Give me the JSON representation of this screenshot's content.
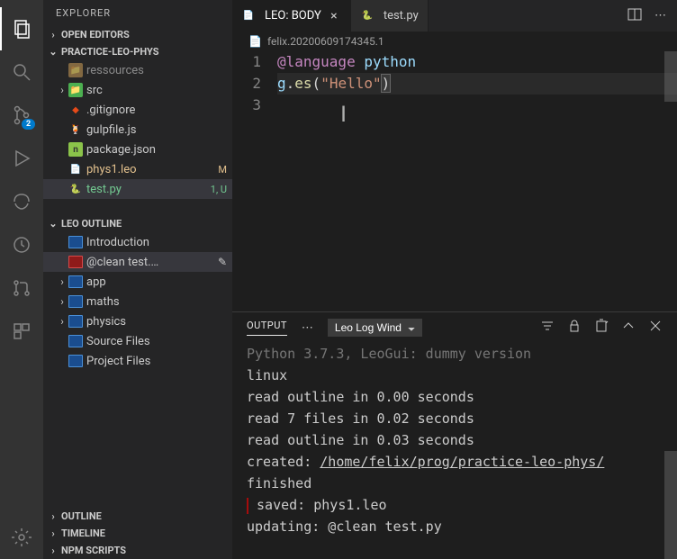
{
  "sidebar": {
    "title": "EXPLORER",
    "sections": {
      "openEditors": {
        "label": "OPEN EDITORS"
      },
      "project": {
        "label": "PRACTICE-LEO-PHYS",
        "items": [
          {
            "name": "ressources",
            "kind": "folder-partial"
          },
          {
            "name": "src",
            "kind": "folder",
            "chevron": "›"
          },
          {
            "name": ".gitignore",
            "kind": "git"
          },
          {
            "name": "gulpfile.js",
            "kind": "gulp"
          },
          {
            "name": "package.json",
            "kind": "npm"
          },
          {
            "name": "phys1.leo",
            "kind": "leo",
            "status": "M",
            "modified": true
          },
          {
            "name": "test.py",
            "kind": "python",
            "status": "1, U",
            "untracked": true,
            "selected": true
          }
        ]
      },
      "leoOutline": {
        "label": "LEO OUTLINE",
        "items": [
          {
            "name": "Introduction",
            "chevron": ""
          },
          {
            "name": "@clean test.…",
            "chevron": "",
            "dirty": true,
            "selected": true,
            "editIcon": true
          },
          {
            "name": "app",
            "chevron": "›"
          },
          {
            "name": "maths",
            "chevron": "›"
          },
          {
            "name": "physics",
            "chevron": "›"
          },
          {
            "name": "Source Files",
            "chevron": ""
          },
          {
            "name": "Project Files",
            "chevron": ""
          }
        ]
      },
      "outline": {
        "label": "OUTLINE"
      },
      "timeline": {
        "label": "TIMELINE"
      },
      "npm": {
        "label": "NPM SCRIPTS"
      }
    }
  },
  "activityBar": {
    "scmBadge": "2"
  },
  "tabs": [
    {
      "label": "LEO: BODY",
      "icon": "leo",
      "active": true,
      "closable": true
    },
    {
      "label": "test.py",
      "icon": "python",
      "active": false
    }
  ],
  "breadcrumb": {
    "text": "felix.20200609174345.1"
  },
  "editor": {
    "lines": [
      "1",
      "2",
      "3"
    ],
    "code": {
      "l1_keyword": "@language",
      "l1_arg": " python",
      "l2_obj": "g",
      "l2_dot": ".",
      "l2_func": "es",
      "l2_open": "(",
      "l2_str": "\"Hello\"",
      "l2_close": ")"
    }
  },
  "panel": {
    "tab": "OUTPUT",
    "selector": "Leo Log Wind",
    "lines": {
      "l0": "Python 3.7.3, LeoGui: dummy version",
      "l1": "linux",
      "l2": "read outline in 0.00 seconds",
      "l3": "read 7 files in 0.02 seconds",
      "l4": "read outline in 0.03 seconds",
      "l5_prefix": "created: ",
      "l5_link": "/home/felix/prog/practice-leo-phys/",
      "l6": "finished",
      "l7": " saved: phys1.leo",
      "l8": "updating: @clean test.py"
    }
  }
}
